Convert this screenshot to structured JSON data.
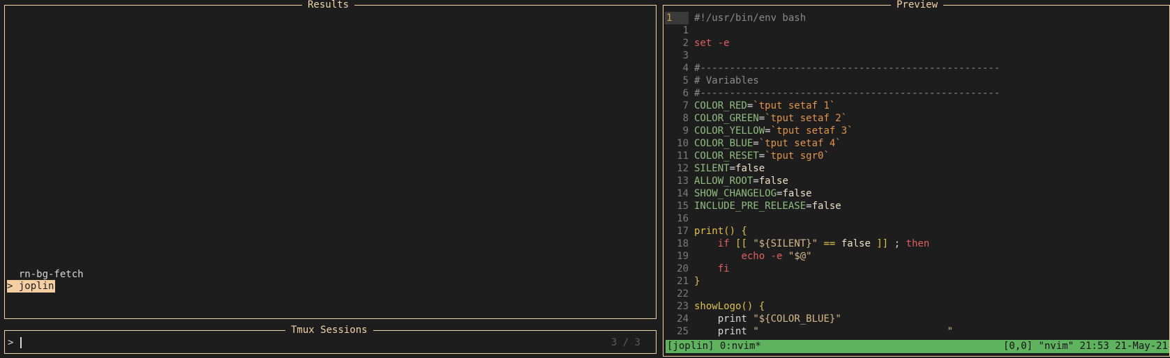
{
  "results": {
    "title": "Results",
    "items": [
      {
        "label": "  rn-bg-fetch",
        "selected": false
      },
      {
        "label": "> joplin",
        "selected": true
      }
    ]
  },
  "sessions": {
    "title": "Tmux Sessions",
    "prompt": ">",
    "query": "",
    "count": "3 / 3"
  },
  "preview": {
    "title": "Preview",
    "lines": [
      {
        "n": "1",
        "text": "#!/usr/bin/env bash"
      },
      {
        "n": "1",
        "text": ""
      },
      {
        "n": "2",
        "text": "set -e"
      },
      {
        "n": "3",
        "text": ""
      },
      {
        "n": "4",
        "text": "#---------------------------------------------------"
      },
      {
        "n": "5",
        "text": "# Variables"
      },
      {
        "n": "6",
        "text": "#---------------------------------------------------"
      },
      {
        "n": "7",
        "text": "COLOR_RED=`tput setaf 1`"
      },
      {
        "n": "8",
        "text": "COLOR_GREEN=`tput setaf 2`"
      },
      {
        "n": "9",
        "text": "COLOR_YELLOW=`tput setaf 3`"
      },
      {
        "n": "10",
        "text": "COLOR_BLUE=`tput setaf 4`"
      },
      {
        "n": "11",
        "text": "COLOR_RESET=`tput sgr0`"
      },
      {
        "n": "12",
        "text": "SILENT=false"
      },
      {
        "n": "13",
        "text": "ALLOW_ROOT=false"
      },
      {
        "n": "14",
        "text": "SHOW_CHANGELOG=false"
      },
      {
        "n": "15",
        "text": "INCLUDE_PRE_RELEASE=false"
      },
      {
        "n": "16",
        "text": ""
      },
      {
        "n": "17",
        "text": "print() {"
      },
      {
        "n": "18",
        "text": "    if [[ \"${SILENT}\" == false ]] ; then"
      },
      {
        "n": "19",
        "text": "        echo -e \"$@\""
      },
      {
        "n": "20",
        "text": "    fi"
      },
      {
        "n": "21",
        "text": "}"
      },
      {
        "n": "22",
        "text": ""
      },
      {
        "n": "23",
        "text": "showLogo() {"
      },
      {
        "n": "24",
        "text": "    print \"${COLOR_BLUE}\""
      },
      {
        "n": "25",
        "text": "    print \"                                \""
      }
    ],
    "status_left": "[joplin] 0:nvim*",
    "status_right": "[0,0] \"nvim\" 21:53 21-May-21"
  },
  "colors": {
    "border": "#f2d3a8",
    "background": "#1d1d1d",
    "selection": "#f5cfa3",
    "statusbar": "#5fb35f"
  }
}
